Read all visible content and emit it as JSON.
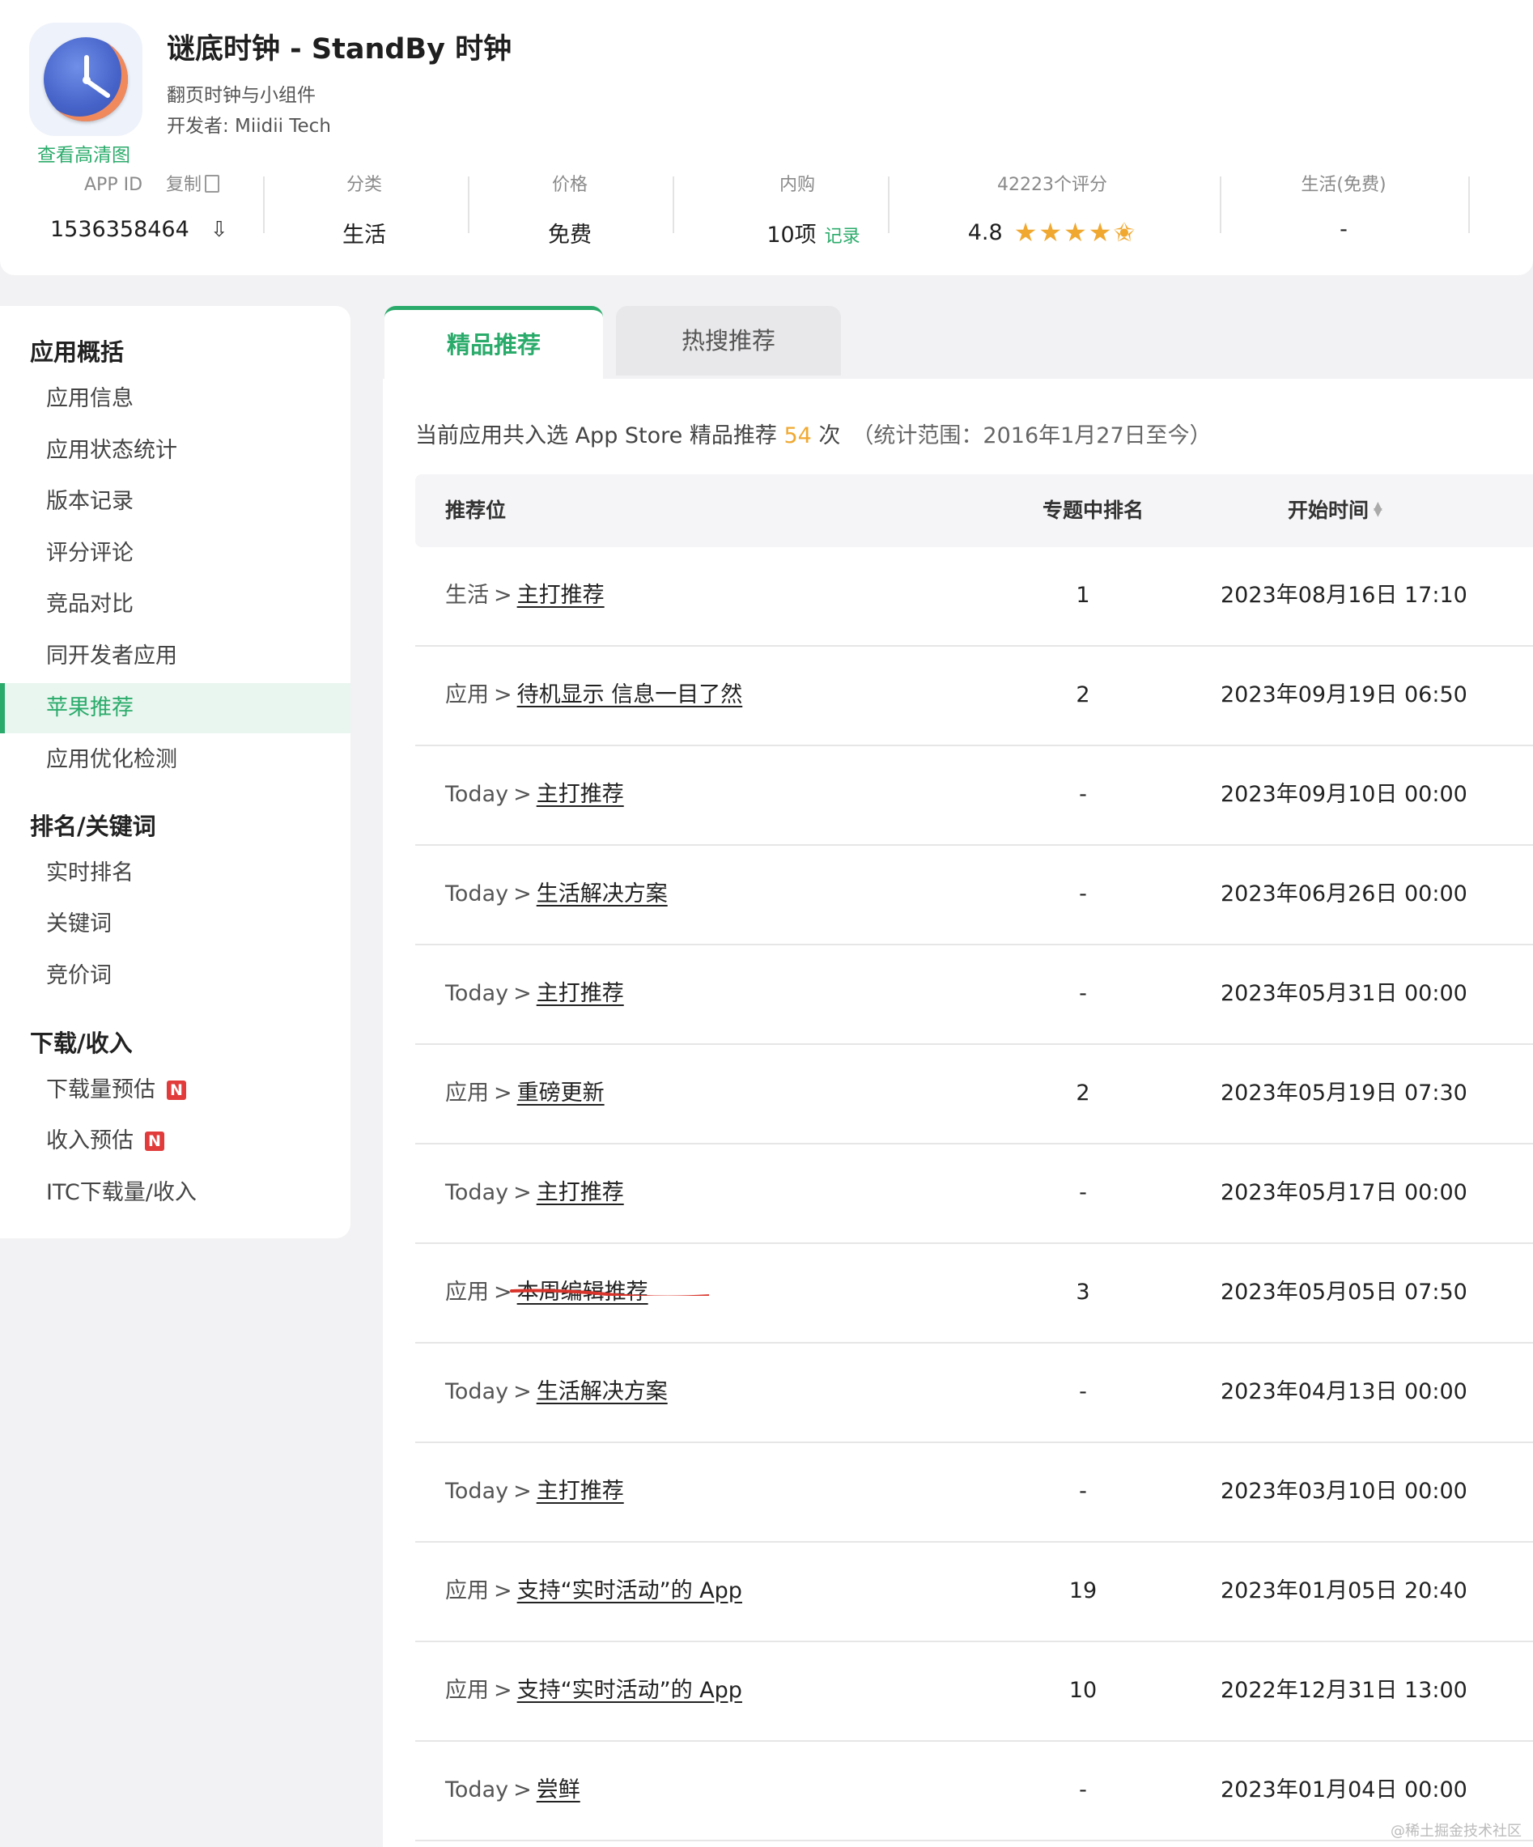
{
  "app": {
    "title": "谜底时钟 - StandBy 时钟",
    "subtitle": "翻页时钟与小组件",
    "developer": "开发者: Miidii Tech",
    "hd_link": "查看高清图"
  },
  "stats": {
    "appid_label": "APP ID",
    "copy_label": "复制",
    "appid_value": "1536358464",
    "category_label": "分类",
    "category_value": "生活",
    "price_label": "价格",
    "price_value": "免费",
    "iap_label": "内购",
    "iap_value": "10项",
    "iap_link": "记录",
    "rating_label": "42223个评分",
    "rating_value": "4.8",
    "rating_stars": 4.5,
    "rank_label": "生活(免费)",
    "rank_value": "-"
  },
  "sidebar": {
    "group1": "应用概括",
    "group1_items": [
      "应用信息",
      "应用状态统计",
      "版本记录",
      "评分评论",
      "竞品对比",
      "同开发者应用",
      "苹果推荐",
      "应用优化检测"
    ],
    "active_item": "苹果推荐",
    "group2": "排名/关键词",
    "group2_items": [
      "实时排名",
      "关键词",
      "竞价词"
    ],
    "group3": "下载/收入",
    "group3_items": [
      "下载量预估",
      "收入预估",
      "ITC下载量/收入"
    ],
    "badge": "N"
  },
  "tabs": [
    "精品推荐",
    "热搜推荐"
  ],
  "summary": {
    "prefix": "当前应用共入选 App Store 精品推荐",
    "count": "54",
    "suffix": "次",
    "range": "（统计范围：2016年1月27日至今）"
  },
  "table": {
    "headers": [
      "推荐位",
      "专题中排名",
      "开始时间"
    ],
    "rows": [
      {
        "category": "生活",
        "topic": "主打推荐",
        "rank": "1",
        "time": "2023年08月16日 17:10"
      },
      {
        "category": "应用",
        "topic": "待机显示 信息一目了然",
        "rank": "2",
        "time": "2023年09月19日 06:50"
      },
      {
        "category": "Today",
        "topic": "主打推荐",
        "rank": "-",
        "time": "2023年09月10日 00:00"
      },
      {
        "category": "Today",
        "topic": "生活解决方案",
        "rank": "-",
        "time": "2023年06月26日 00:00"
      },
      {
        "category": "Today",
        "topic": "主打推荐",
        "rank": "-",
        "time": "2023年05月31日 00:00"
      },
      {
        "category": "应用",
        "topic": "重磅更新",
        "rank": "2",
        "time": "2023年05月19日 07:30"
      },
      {
        "category": "Today",
        "topic": "主打推荐",
        "rank": "-",
        "time": "2023年05月17日 00:00"
      },
      {
        "category": "应用",
        "topic": "本周编辑推荐",
        "rank": "3",
        "time": "2023年05月05日 07:50"
      },
      {
        "category": "Today",
        "topic": "生活解决方案",
        "rank": "-",
        "time": "2023年04月13日 00:00"
      },
      {
        "category": "Today",
        "topic": "主打推荐",
        "rank": "-",
        "time": "2023年03月10日 00:00"
      },
      {
        "category": "应用",
        "topic": "支持“实时活动”的 App",
        "rank": "19",
        "time": "2023年01月05日 20:40"
      },
      {
        "category": "应用",
        "topic": "支持“实时活动”的 App",
        "rank": "10",
        "time": "2022年12月31日 13:00"
      },
      {
        "category": "Today",
        "topic": "尝鲜",
        "rank": "-",
        "time": "2023年01月04日 00:00"
      }
    ]
  },
  "watermark": "@稀土掘金技术社区"
}
